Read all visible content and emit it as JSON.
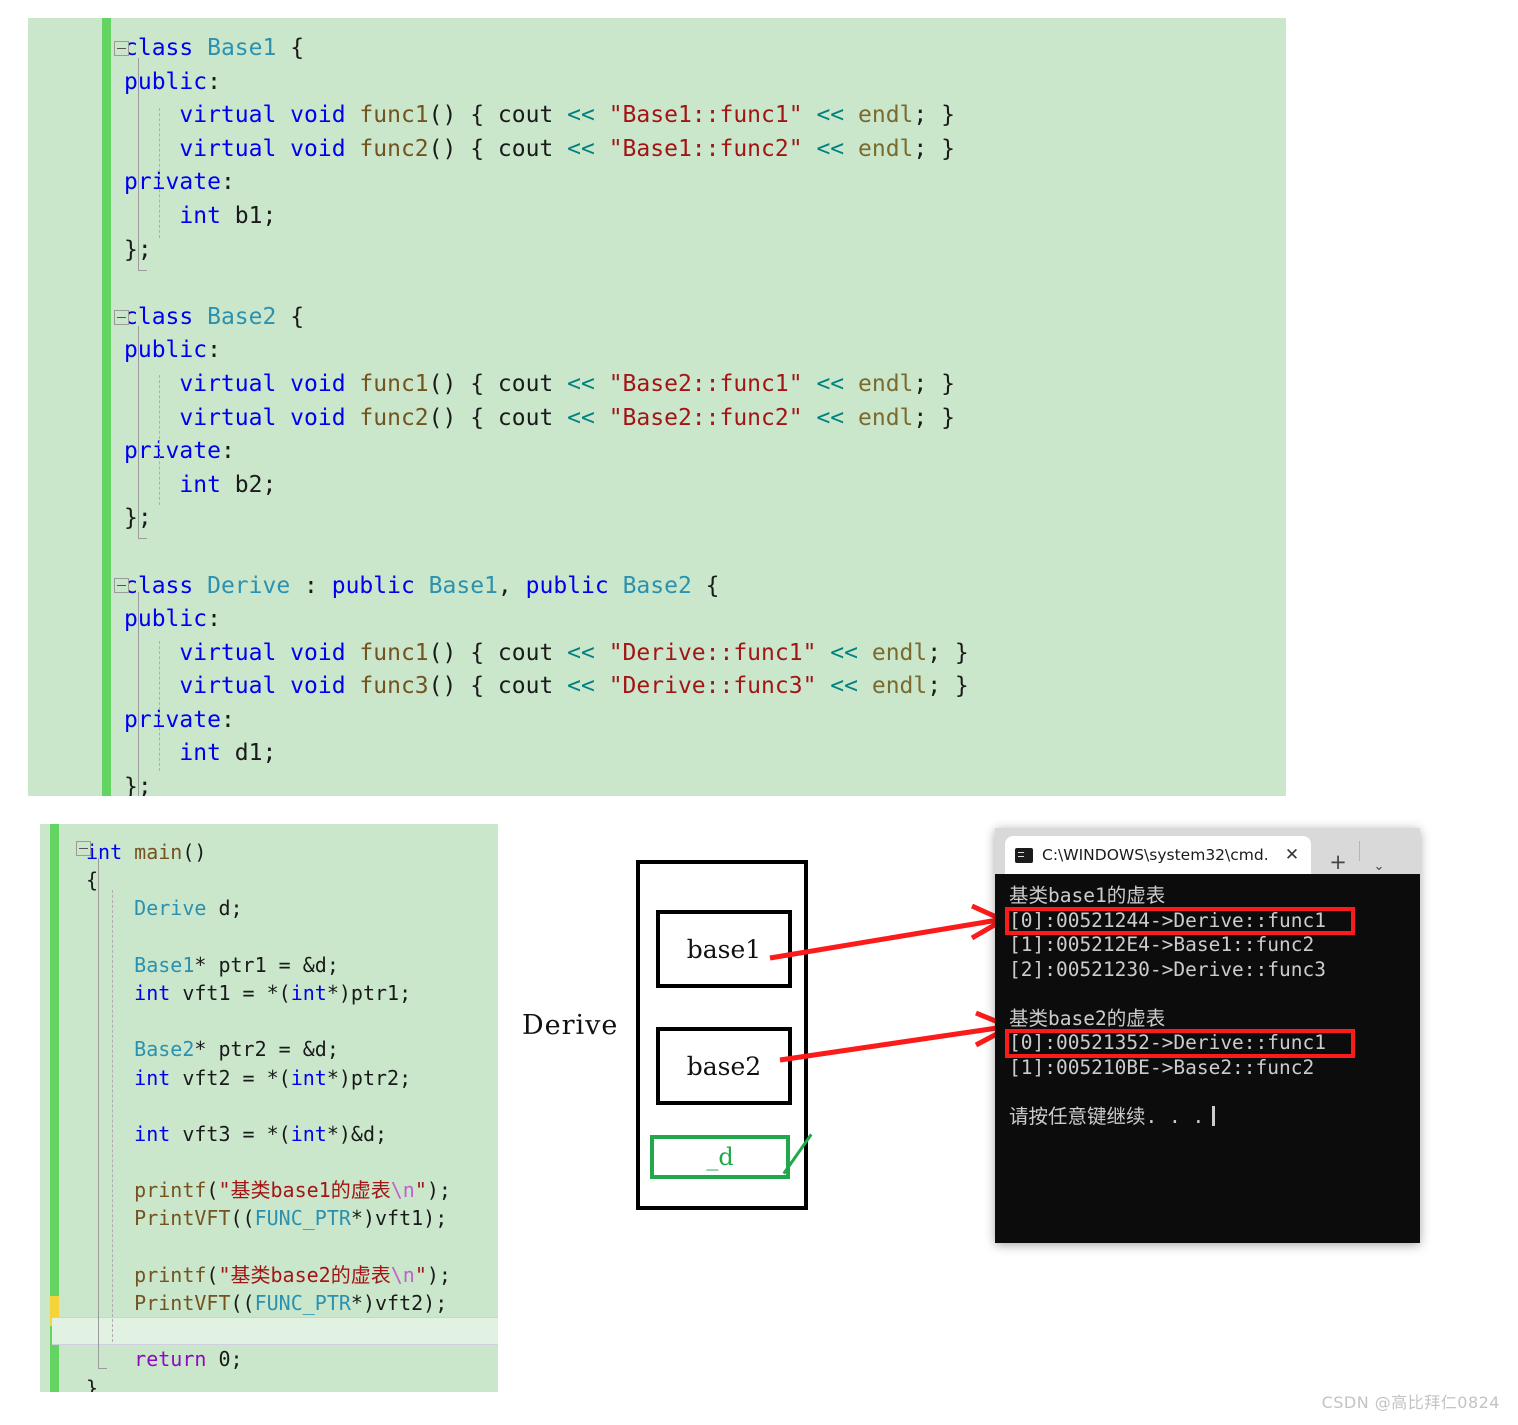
{
  "editor_top": {
    "lines": [
      [
        {
          "t": "class ",
          "c": "kw"
        },
        {
          "t": "Base1 ",
          "c": "typ"
        },
        {
          "t": "{",
          "c": "pun"
        }
      ],
      [
        {
          "t": "public",
          "c": "kw"
        },
        {
          "t": ":",
          "c": "pun"
        }
      ],
      [
        {
          "t": "    virtual void ",
          "c": "kw"
        },
        {
          "t": "func1",
          "c": "fn"
        },
        {
          "t": "() { cout ",
          "c": "pun"
        },
        {
          "t": "<<",
          "c": "op"
        },
        {
          "t": " ",
          "c": "pun"
        },
        {
          "t": "\"Base1::func1\"",
          "c": "str"
        },
        {
          "t": " ",
          "c": "pun"
        },
        {
          "t": "<<",
          "c": "op"
        },
        {
          "t": " ",
          "c": "pun"
        },
        {
          "t": "endl",
          "c": "id"
        },
        {
          "t": "; }",
          "c": "pun"
        }
      ],
      [
        {
          "t": "    virtual void ",
          "c": "kw"
        },
        {
          "t": "func2",
          "c": "fn"
        },
        {
          "t": "() { cout ",
          "c": "pun"
        },
        {
          "t": "<<",
          "c": "op"
        },
        {
          "t": " ",
          "c": "pun"
        },
        {
          "t": "\"Base1::func2\"",
          "c": "str"
        },
        {
          "t": " ",
          "c": "pun"
        },
        {
          "t": "<<",
          "c": "op"
        },
        {
          "t": " ",
          "c": "pun"
        },
        {
          "t": "endl",
          "c": "id"
        },
        {
          "t": "; }",
          "c": "pun"
        }
      ],
      [
        {
          "t": "private",
          "c": "kw"
        },
        {
          "t": ":",
          "c": "pun"
        }
      ],
      [
        {
          "t": "    int ",
          "c": "kw"
        },
        {
          "t": "b1;",
          "c": "plain"
        }
      ],
      [
        {
          "t": "};",
          "c": "pun"
        }
      ],
      [],
      [
        {
          "t": "class ",
          "c": "kw"
        },
        {
          "t": "Base2 ",
          "c": "typ"
        },
        {
          "t": "{",
          "c": "pun"
        }
      ],
      [
        {
          "t": "public",
          "c": "kw"
        },
        {
          "t": ":",
          "c": "pun"
        }
      ],
      [
        {
          "t": "    virtual void ",
          "c": "kw"
        },
        {
          "t": "func1",
          "c": "fn"
        },
        {
          "t": "() { cout ",
          "c": "pun"
        },
        {
          "t": "<<",
          "c": "op"
        },
        {
          "t": " ",
          "c": "pun"
        },
        {
          "t": "\"Base2::func1\"",
          "c": "str"
        },
        {
          "t": " ",
          "c": "pun"
        },
        {
          "t": "<<",
          "c": "op"
        },
        {
          "t": " ",
          "c": "pun"
        },
        {
          "t": "endl",
          "c": "id"
        },
        {
          "t": "; }",
          "c": "pun"
        }
      ],
      [
        {
          "t": "    virtual void ",
          "c": "kw"
        },
        {
          "t": "func2",
          "c": "fn"
        },
        {
          "t": "() { cout ",
          "c": "pun"
        },
        {
          "t": "<<",
          "c": "op"
        },
        {
          "t": " ",
          "c": "pun"
        },
        {
          "t": "\"Base2::func2\"",
          "c": "str"
        },
        {
          "t": " ",
          "c": "pun"
        },
        {
          "t": "<<",
          "c": "op"
        },
        {
          "t": " ",
          "c": "pun"
        },
        {
          "t": "endl",
          "c": "id"
        },
        {
          "t": "; }",
          "c": "pun"
        }
      ],
      [
        {
          "t": "private",
          "c": "kw"
        },
        {
          "t": ":",
          "c": "pun"
        }
      ],
      [
        {
          "t": "    int ",
          "c": "kw"
        },
        {
          "t": "b2;",
          "c": "plain"
        }
      ],
      [
        {
          "t": "};",
          "c": "pun"
        }
      ],
      [],
      [
        {
          "t": "class ",
          "c": "kw"
        },
        {
          "t": "Derive ",
          "c": "typ"
        },
        {
          "t": ": ",
          "c": "pun"
        },
        {
          "t": "public ",
          "c": "kw"
        },
        {
          "t": "Base1",
          "c": "typ"
        },
        {
          "t": ", ",
          "c": "pun"
        },
        {
          "t": "public ",
          "c": "kw"
        },
        {
          "t": "Base2 ",
          "c": "typ"
        },
        {
          "t": "{",
          "c": "pun"
        }
      ],
      [
        {
          "t": "public",
          "c": "kw"
        },
        {
          "t": ":",
          "c": "pun"
        }
      ],
      [
        {
          "t": "    virtual void ",
          "c": "kw"
        },
        {
          "t": "func1",
          "c": "fn"
        },
        {
          "t": "() { cout ",
          "c": "pun"
        },
        {
          "t": "<<",
          "c": "op"
        },
        {
          "t": " ",
          "c": "pun"
        },
        {
          "t": "\"Derive::func1\"",
          "c": "str"
        },
        {
          "t": " ",
          "c": "pun"
        },
        {
          "t": "<<",
          "c": "op"
        },
        {
          "t": " ",
          "c": "pun"
        },
        {
          "t": "endl",
          "c": "id"
        },
        {
          "t": "; }",
          "c": "pun"
        }
      ],
      [
        {
          "t": "    virtual void ",
          "c": "kw"
        },
        {
          "t": "func3",
          "c": "fn"
        },
        {
          "t": "() { cout ",
          "c": "pun"
        },
        {
          "t": "<<",
          "c": "op"
        },
        {
          "t": " ",
          "c": "pun"
        },
        {
          "t": "\"Derive::func3\"",
          "c": "str"
        },
        {
          "t": " ",
          "c": "pun"
        },
        {
          "t": "<<",
          "c": "op"
        },
        {
          "t": " ",
          "c": "pun"
        },
        {
          "t": "endl",
          "c": "id"
        },
        {
          "t": "; }",
          "c": "pun"
        }
      ],
      [
        {
          "t": "private",
          "c": "kw"
        },
        {
          "t": ":",
          "c": "pun"
        }
      ],
      [
        {
          "t": "    int ",
          "c": "kw"
        },
        {
          "t": "d1;",
          "c": "plain"
        }
      ],
      [
        {
          "t": "};",
          "c": "pun"
        }
      ],
      [
        {
          "t": "};",
          "c": "pun"
        }
      ]
    ]
  },
  "editor_bottom": {
    "lines": [
      [
        {
          "t": "int ",
          "c": "kw"
        },
        {
          "t": "main",
          "c": "fn"
        },
        {
          "t": "()",
          "c": "pun"
        }
      ],
      [
        {
          "t": "{",
          "c": "pun"
        }
      ],
      [
        {
          "t": "    ",
          "c": "pun"
        },
        {
          "t": "Derive ",
          "c": "typ"
        },
        {
          "t": "d;",
          "c": "plain"
        }
      ],
      [],
      [
        {
          "t": "    ",
          "c": "pun"
        },
        {
          "t": "Base1",
          "c": "typ"
        },
        {
          "t": "* ptr1 = &d;",
          "c": "plain"
        }
      ],
      [
        {
          "t": "    int ",
          "c": "kw"
        },
        {
          "t": "vft1 = *(",
          "c": "plain"
        },
        {
          "t": "int",
          "c": "kw"
        },
        {
          "t": "*)ptr1;",
          "c": "plain"
        }
      ],
      [],
      [
        {
          "t": "    ",
          "c": "pun"
        },
        {
          "t": "Base2",
          "c": "typ"
        },
        {
          "t": "* ptr2 = &d;",
          "c": "plain"
        }
      ],
      [
        {
          "t": "    int ",
          "c": "kw"
        },
        {
          "t": "vft2 = *(",
          "c": "plain"
        },
        {
          "t": "int",
          "c": "kw"
        },
        {
          "t": "*)ptr2;",
          "c": "plain"
        }
      ],
      [],
      [
        {
          "t": "    int ",
          "c": "kw"
        },
        {
          "t": "vft3 = *(",
          "c": "plain"
        },
        {
          "t": "int",
          "c": "kw"
        },
        {
          "t": "*)&d;",
          "c": "plain"
        }
      ],
      [],
      [
        {
          "t": "    ",
          "c": "pun"
        },
        {
          "t": "printf",
          "c": "fn"
        },
        {
          "t": "(",
          "c": "pun"
        },
        {
          "t": "\"基类base1的虚表",
          "c": "str"
        },
        {
          "t": "\\n",
          "c": "esc"
        },
        {
          "t": "\"",
          "c": "str"
        },
        {
          "t": ");",
          "c": "pun"
        }
      ],
      [
        {
          "t": "    ",
          "c": "pun"
        },
        {
          "t": "PrintVFT",
          "c": "fn"
        },
        {
          "t": "((",
          "c": "pun"
        },
        {
          "t": "FUNC_PTR",
          "c": "typ"
        },
        {
          "t": "*)vft1);",
          "c": "plain"
        }
      ],
      [],
      [
        {
          "t": "    ",
          "c": "pun"
        },
        {
          "t": "printf",
          "c": "fn"
        },
        {
          "t": "(",
          "c": "pun"
        },
        {
          "t": "\"基类base2的虚表",
          "c": "str"
        },
        {
          "t": "\\n",
          "c": "esc"
        },
        {
          "t": "\"",
          "c": "str"
        },
        {
          "t": ");",
          "c": "pun"
        }
      ],
      [
        {
          "t": "    ",
          "c": "pun"
        },
        {
          "t": "PrintVFT",
          "c": "fn"
        },
        {
          "t": "((",
          "c": "pun"
        },
        {
          "t": "FUNC_PTR",
          "c": "typ"
        },
        {
          "t": "*)vft2);",
          "c": "plain"
        }
      ],
      [],
      [
        {
          "t": "    return ",
          "c": "ret"
        },
        {
          "t": "0;",
          "c": "plain"
        }
      ],
      [
        {
          "t": "}",
          "c": "pun"
        }
      ]
    ],
    "current_line_index": 17
  },
  "diagram": {
    "object_label": "Derive",
    "base1_label": "base1",
    "base2_label": "base2",
    "member_label": "_d"
  },
  "console": {
    "tab_title": "C:\\WINDOWS\\system32\\cmd.",
    "close_label": "✕",
    "new_tab_label": "+",
    "dropdown_label": "⌄",
    "icon_name": "terminal-icon",
    "lines": [
      "基类base1的虚表",
      "[0]:00521244->Derive::func1",
      "[1]:005212E4->Base1::func2",
      "[2]:00521230->Derive::func3",
      "",
      "基类base2的虚表",
      "[0]:00521352->Derive::func1",
      "[1]:005210BE->Base2::func2",
      "",
      "请按任意键继续. . ."
    ],
    "highlight_line_indices": [
      1,
      6
    ],
    "highlight_color": "#fb1b1b"
  },
  "watermark": {
    "text": "CSDN @高比拜仁0824"
  },
  "colors": {
    "editor_background": "#cae7cc",
    "change_bar_green": "#63d461",
    "change_bar_yellow": "#f5d33a",
    "console_background": "#0c0c0c",
    "console_text": "#cccccc",
    "annotation_red": "#fb1b1b",
    "annotation_green": "#21a84b"
  }
}
